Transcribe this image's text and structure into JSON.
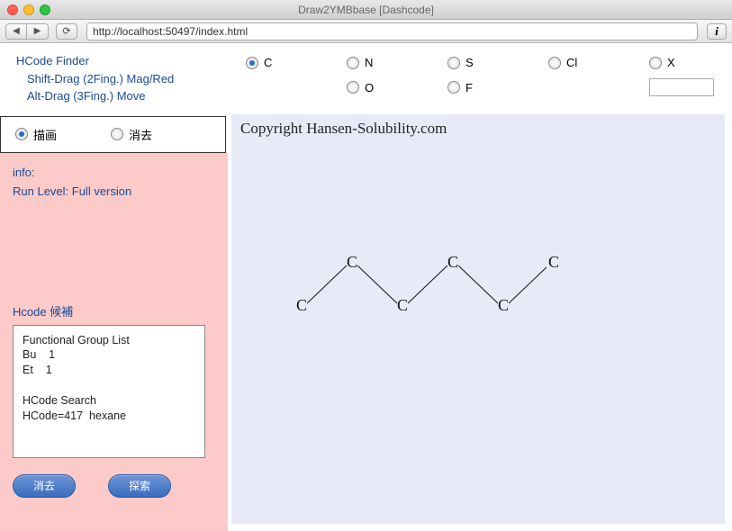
{
  "window": {
    "title": "Draw2YMBbase [Dashcode]"
  },
  "toolbar": {
    "url": "http://localhost:50497/index.html"
  },
  "sidebar": {
    "title": "HCode Finder",
    "hint1": "Shift-Drag (2Fing.) Mag/Red",
    "hint2": "Alt-Drag (3Fing.) Move"
  },
  "mode": {
    "draw": "描画",
    "erase": "消去",
    "selected": "draw"
  },
  "info": {
    "label": "info:",
    "runlevel": "Run Level: Full version",
    "candidates_label": "Hcode 候補"
  },
  "listbox": {
    "line1": "Functional Group List",
    "line2": "Bu    1",
    "line3": "Et    1",
    "line4": "",
    "line5": "HCode Search",
    "line6": "HCode=417  hexane"
  },
  "buttons": {
    "clear": "消去",
    "search": "探索"
  },
  "elements": {
    "row1": [
      "C",
      "N",
      "S",
      "Cl",
      "X"
    ],
    "row2": [
      "O",
      "F"
    ],
    "selected": "C",
    "input_value": ""
  },
  "canvas": {
    "copyright": "Copyright Hansen-Solubility.com",
    "atoms": [
      "C",
      "C",
      "C",
      "C",
      "C",
      "C"
    ]
  }
}
